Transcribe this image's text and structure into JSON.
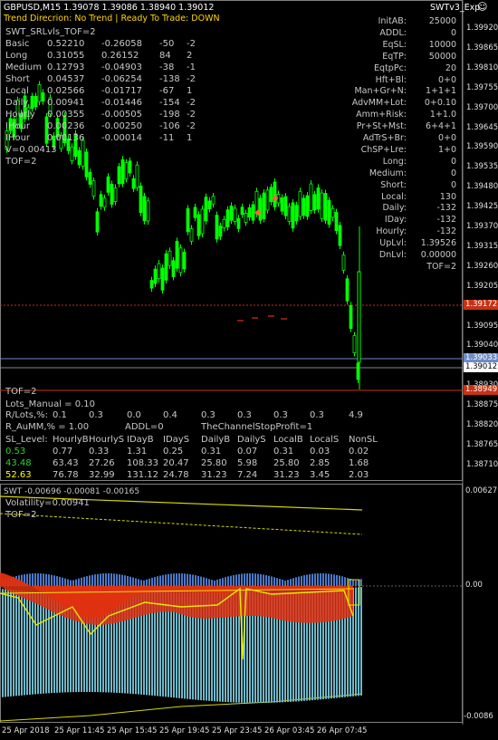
{
  "header": {
    "symbol_line": "GBPUSD,M15  1.39078 1.39086 1.38940 1.39012",
    "trend_line": "Trend Direcrion:  No Trend  |  Ready To Trade:  DOWN",
    "expert_name": "SWTv3_Exp",
    "smiley": "☺"
  },
  "left_info": {
    "title": "SWT_SRLvls_TOF=2",
    "rows": [
      {
        "name": "Basic",
        "a": "0.52210",
        "b": "-0.26058",
        "c": "-50",
        "d": "-2"
      },
      {
        "name": "Long",
        "a": "0.31055",
        "b": "0.26152",
        "c": "84",
        "d": "2"
      },
      {
        "name": "Medium",
        "a": "0.12793",
        "b": "-0.04903",
        "c": "-38",
        "d": "-1"
      },
      {
        "name": "Short",
        "a": "0.04537",
        "b": "-0.06254",
        "c": "-138",
        "d": "-2"
      },
      {
        "name": "Local",
        "a": "0.02566",
        "b": "-0.01717",
        "c": "-67",
        "d": "1"
      },
      {
        "name": "Daily",
        "a": "0.00941",
        "b": "-0.01446",
        "c": "-154",
        "d": "-2"
      },
      {
        "name": "Hourly",
        "a": "0.00355",
        "b": "-0.00505",
        "c": "-198",
        "d": "-2"
      },
      {
        "name": "IHour",
        "a": "0.00236",
        "b": "-0.00250",
        "c": "-106",
        "d": "-2"
      },
      {
        "name": "IHour",
        "a": "0.00136",
        "b": "-0.00014",
        "c": "-11",
        "d": "1"
      }
    ],
    "v_line": "V=0.00413",
    "tof": "TOF=2"
  },
  "right_info": {
    "rows": [
      {
        "k": "InitAB:",
        "v": "25000"
      },
      {
        "k": "ADDL:",
        "v": "0"
      },
      {
        "k": "EqSL:",
        "v": "10000"
      },
      {
        "k": "EqTP:",
        "v": "50000"
      },
      {
        "k": "EqtpPc:",
        "v": "20"
      },
      {
        "k": "Hft+Bl:",
        "v": "0+0"
      },
      {
        "k": "Man+Gr+N:",
        "v": "1+1+1"
      },
      {
        "k": "AdvMM+Lot:",
        "v": "0+0.10"
      },
      {
        "k": "Amm+Risk:",
        "v": "1+1.0"
      },
      {
        "k": "Pr+St+Mst:",
        "v": "6+4+1"
      },
      {
        "k": "AdTrS+Br:",
        "v": "0+0"
      },
      {
        "k": "ChSP+Lre:",
        "v": "1+0"
      },
      {
        "k": "Long:",
        "v": "0"
      },
      {
        "k": "Medium:",
        "v": "0"
      },
      {
        "k": "Short:",
        "v": "0"
      },
      {
        "k": "Local:",
        "v": "130"
      },
      {
        "k": "Daily:",
        "v": "-132"
      },
      {
        "k": "IDay:",
        "v": "-132"
      },
      {
        "k": "Hourly:",
        "v": "-132"
      },
      {
        "k": "UpLvl:",
        "v": "1.39526"
      },
      {
        "k": "DnLvl:",
        "v": "0.00000"
      },
      {
        "k": "",
        "v": "TOF=2"
      }
    ]
  },
  "price_axis": [
    "1.39920",
    "1.39865",
    "1.39810",
    "1.39755",
    "1.39700",
    "1.39645",
    "1.39590",
    "1.39535",
    "1.39480",
    "1.39425",
    "1.39370",
    "1.39315",
    "1.39260",
    "1.39205",
    "1.39150",
    "1.39095",
    "1.39040",
    "1.38985",
    "1.38930",
    "1.38875",
    "1.38820",
    "1.38765",
    "1.38710"
  ],
  "price_tags": {
    "red1": "1.39172",
    "blue": "1.39033",
    "white": "1.39012",
    "red2": "1.38949"
  },
  "bottom_info": {
    "tof": "TOF=2",
    "lots_manual": "Lots_Manual = 0.10",
    "r_lots_label": "R/Lots,%:",
    "r_lots": [
      "0.1",
      "0.3",
      "0.0",
      "0.4",
      "0.3",
      "0.3",
      "0.3",
      "0.3",
      "4.9"
    ],
    "r_aumm": "R_AuMM,% = 1.00",
    "addl": "ADDL=0",
    "channel": "TheChannelStopProfit=1",
    "sl_headers": [
      "SL_Level:",
      "HourlyB",
      "HourlyS",
      "IDayB",
      "IDayS",
      "DailyB",
      "DailyS",
      "LocalB",
      "LocalS",
      "NonSL"
    ],
    "sl_row1": [
      "0.53",
      "0.77",
      "0.33",
      "1.31",
      "0.25",
      "0.31",
      "0.07",
      "0.31",
      "0.03",
      "0.02"
    ],
    "sl_row2": [
      "43.48",
      "63.43",
      "27.26",
      "108.33",
      "20.47",
      "25.80",
      "5.98",
      "25.80",
      "2.85",
      "1.68"
    ],
    "sl_row3": [
      "52.63",
      "76.78",
      "32.99",
      "131.12",
      "24.78",
      "31.23",
      "7.24",
      "31.23",
      "3.45",
      "2.03"
    ]
  },
  "sub_window": {
    "title": "SWT -0.00696 -0.00081 -0.00165",
    "volatility": "Volatility=0.00941",
    "tof": "TOF=2",
    "axis": [
      "0.00627",
      "0.00",
      "-0.0086"
    ]
  },
  "time_axis": [
    "25 Apr 2018",
    "25 Apr 11:45",
    "25 Apr 15:45",
    "25 Apr 19:45",
    "25 Apr 23:45",
    "26 Apr 03:45",
    "26 Apr 07:45"
  ],
  "colors": {
    "bull": "#00ff00",
    "bear": "#00ff00",
    "info_yellow": "#ffd600",
    "green_text": "#26d626",
    "red_line": "#c83214",
    "blue_line": "#6e8cc8"
  }
}
